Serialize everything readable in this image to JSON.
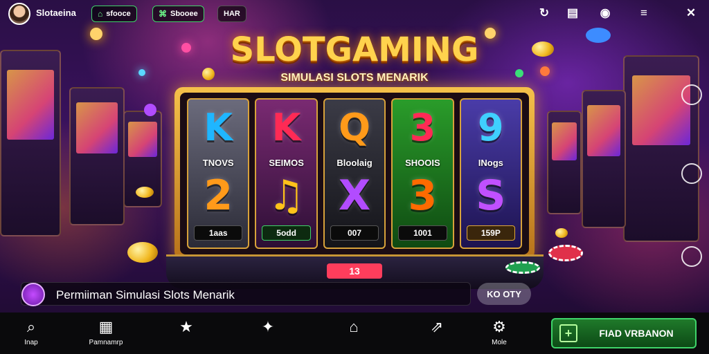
{
  "header": {
    "brand": "Slotaeina",
    "pills": [
      {
        "icon": "⌂",
        "label": "sfooce"
      },
      {
        "icon": "⌘",
        "label": "Sbooee"
      },
      {
        "icon": "",
        "label": "HAR"
      }
    ],
    "right_icons": [
      "refresh-icon",
      "store-icon",
      "shield-icon",
      "menu-icon",
      "close-cross-icon"
    ]
  },
  "title": {
    "main": "SLOTGAMING",
    "sub": "SIMULASI SLOTS MENARIK"
  },
  "reels": [
    {
      "symbol": "K",
      "label": "TNOVS",
      "symbol2": "2",
      "value": "1aas",
      "color": "#1fb6ff",
      "color2": "#ff9a1a"
    },
    {
      "symbol": "K",
      "label": "SEIMOS",
      "symbol2": "♫",
      "value": "5odd",
      "color": "#ff2a55",
      "color2": "#ffc21a"
    },
    {
      "symbol": "Q",
      "label": "Bloolaig",
      "symbol2": "X",
      "value": "007",
      "color": "#ff9a1a",
      "color2": "#b24cff"
    },
    {
      "symbol": "3",
      "label": "SHOOIS",
      "symbol2": "3",
      "value": "1001",
      "color": "#ff2a55",
      "color2": "#ff6a00"
    },
    {
      "symbol": "9",
      "label": "INogs",
      "symbol2": "S",
      "value": "159P",
      "color": "#3fd0ff",
      "color2": "#c050ff"
    }
  ],
  "base": {
    "display": "13"
  },
  "info": {
    "text": "Permiiman Simulasi Slots Menarik",
    "side_button": "KO OTY"
  },
  "nav": [
    {
      "icon": "search-icon",
      "glyph": "⌕",
      "label": "Inap"
    },
    {
      "icon": "grid-icon",
      "glyph": "▦",
      "label": "Pamnamrp"
    },
    {
      "icon": "star-icon",
      "glyph": "★",
      "label": ""
    },
    {
      "icon": "sparkle-icon",
      "glyph": "✦",
      "label": ""
    },
    {
      "icon": "home-icon",
      "glyph": "⌂",
      "label": ""
    },
    {
      "icon": "share-icon",
      "glyph": "⇗",
      "label": ""
    },
    {
      "icon": "settings-icon",
      "glyph": "⚙",
      "label": "Mole"
    }
  ],
  "cta": {
    "label": "FIAD VRBANON",
    "icon": "+"
  }
}
